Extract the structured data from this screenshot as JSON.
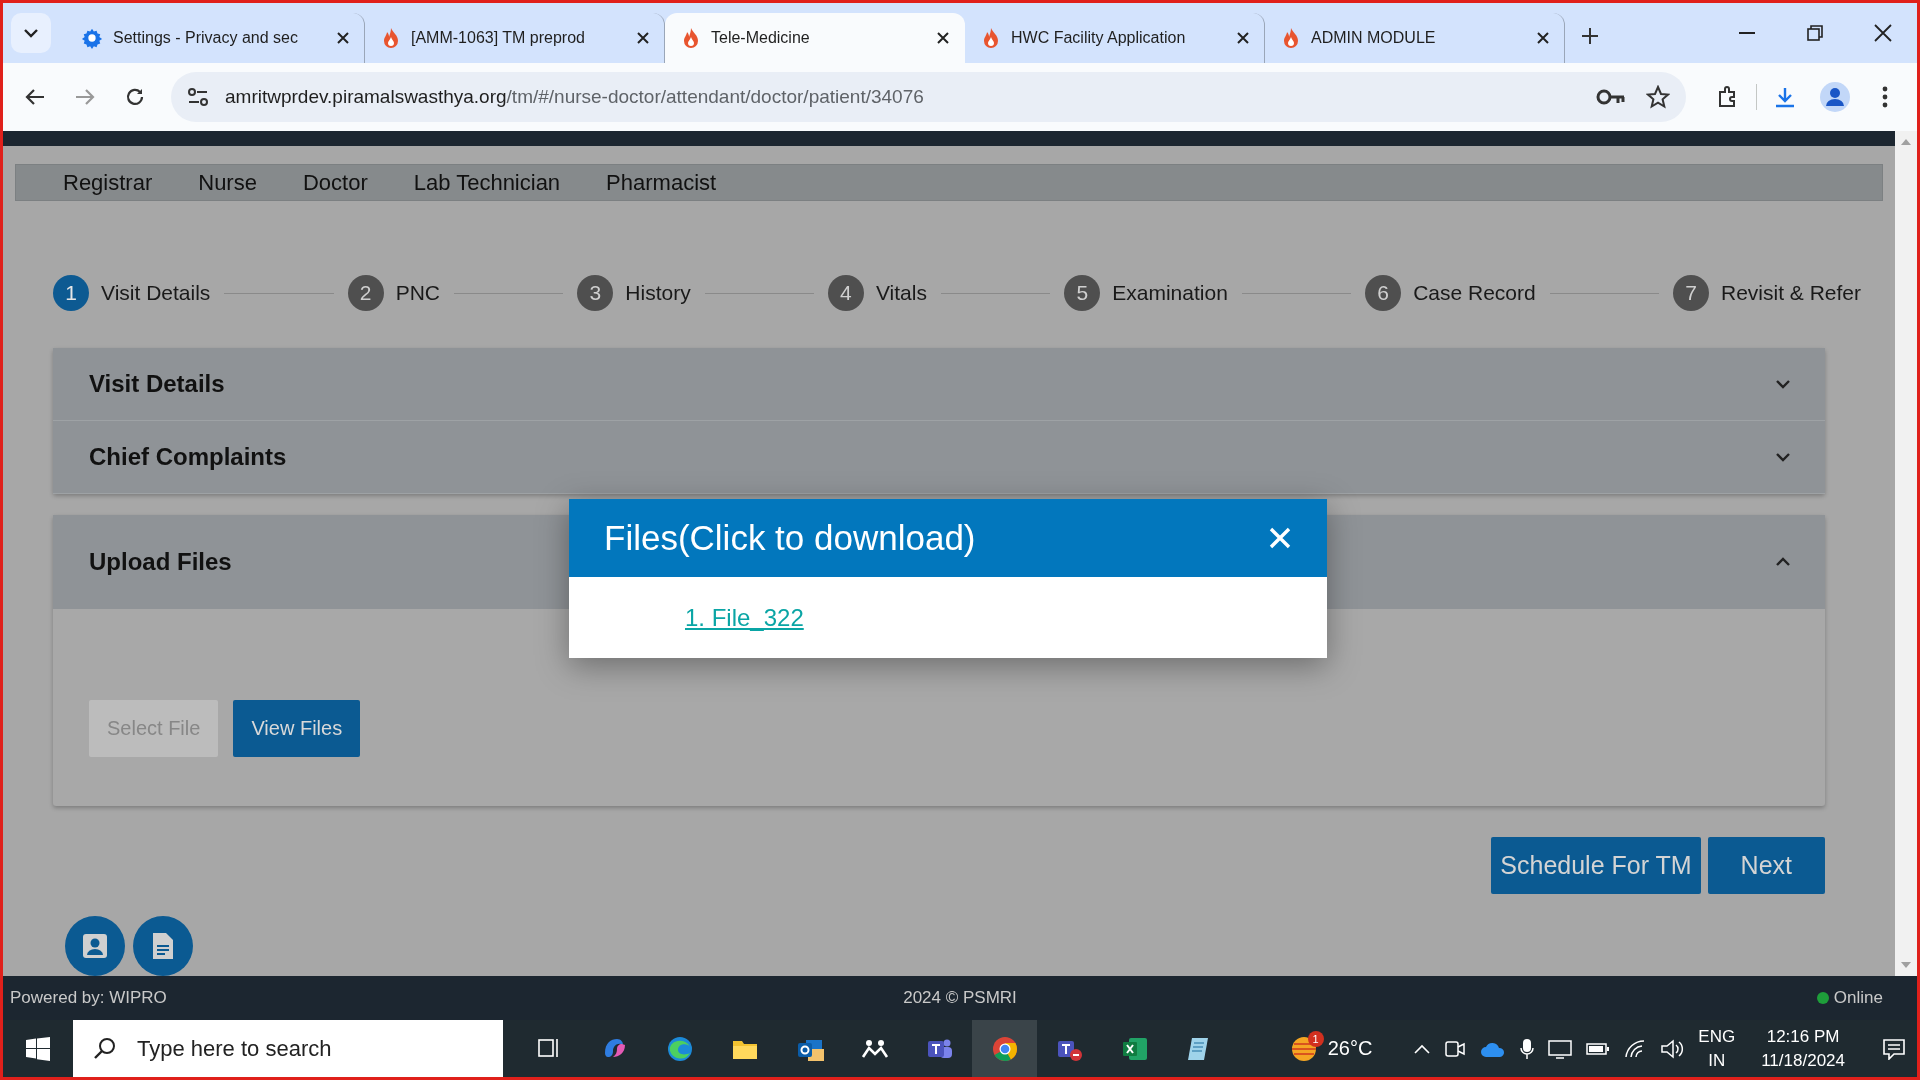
{
  "browser": {
    "tabs": [
      {
        "title": "Settings - Privacy and sec",
        "kind": "settings",
        "selected": false
      },
      {
        "title": "[AMM-1063] TM preprod",
        "kind": "site",
        "selected": false
      },
      {
        "title": "Tele-Medicine",
        "kind": "site",
        "selected": true
      },
      {
        "title": "HWC Facility Application",
        "kind": "site",
        "selected": false
      },
      {
        "title": "ADMIN MODULE",
        "kind": "site",
        "selected": false
      }
    ],
    "address": {
      "host": "amritwprdev.piramalswasthya.org",
      "path": "/tm/#/nurse-doctor/attendant/doctor/patient/34076"
    }
  },
  "roles": [
    "Registrar",
    "Nurse",
    "Doctor",
    "Lab Technician",
    "Pharmacist"
  ],
  "steps": [
    {
      "number": "1",
      "label": "Visit Details",
      "selected": true
    },
    {
      "number": "2",
      "label": "PNC",
      "selected": false
    },
    {
      "number": "3",
      "label": "History",
      "selected": false
    },
    {
      "number": "4",
      "label": "Vitals",
      "selected": false
    },
    {
      "number": "5",
      "label": "Examination",
      "selected": false
    },
    {
      "number": "6",
      "label": "Case Record",
      "selected": false
    },
    {
      "number": "7",
      "label": "Revisit & Refer",
      "selected": false
    }
  ],
  "panels": [
    {
      "sections": [
        {
          "title": "Visit Details",
          "expanded": false
        },
        {
          "title": "Chief Complaints",
          "expanded": false
        }
      ]
    },
    {
      "sections": [
        {
          "title": "Upload Files",
          "expanded": true
        }
      ],
      "buttons": [
        {
          "label": "Select File",
          "disabled": true
        },
        {
          "label": "View Files",
          "disabled": false
        }
      ]
    }
  ],
  "actions": [
    "Schedule For TM",
    "Next"
  ],
  "dialog": {
    "title": "Files(Click to download)",
    "files": [
      "1. File_322"
    ]
  },
  "footer": {
    "powered_by": "Powered by: WIPRO",
    "copyright": "2024 © PSMRI",
    "status": "Online",
    "online": true
  },
  "taskbar": {
    "search_placeholder": "Type here to search",
    "weather": "26°C",
    "weather_badge": "1",
    "language": "ENG",
    "region": "IN",
    "time": "12:16 PM",
    "date": "11/18/2024"
  }
}
